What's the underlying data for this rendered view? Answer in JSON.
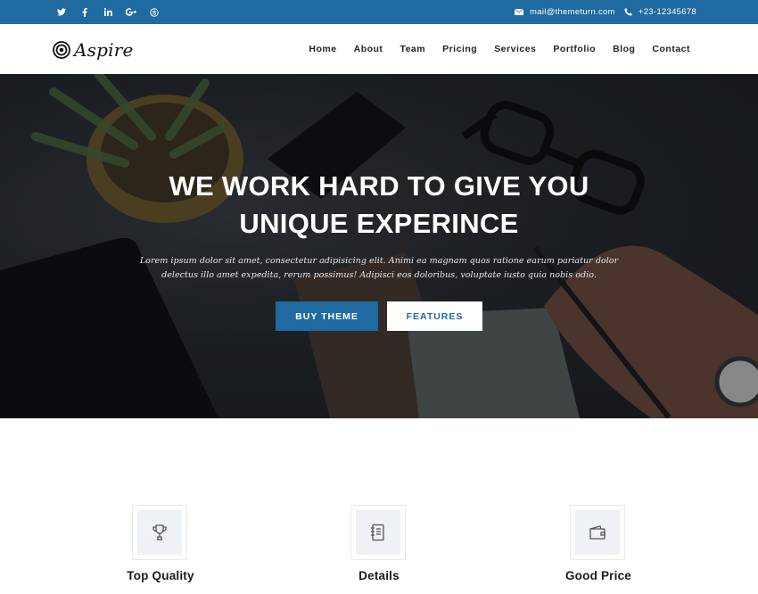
{
  "topbar": {
    "social": [
      {
        "icon": "twitter-icon",
        "glyph": "𝕥"
      },
      {
        "icon": "facebook-icon",
        "glyph": "f"
      },
      {
        "icon": "linkedin-icon",
        "glyph": "in"
      },
      {
        "icon": "google-plus-icon",
        "glyph": "g+"
      },
      {
        "icon": "skype-icon",
        "glyph": "S"
      }
    ],
    "email": "mail@themeturn.com",
    "phone": "+23-12345678",
    "bg_color": "#1f6aa0"
  },
  "navbar": {
    "logo_text": "Aspire",
    "menu": [
      "Home",
      "About",
      "Team",
      "Pricing",
      "Services",
      "Portfolio",
      "Blog",
      "Contact"
    ]
  },
  "hero": {
    "title_line1": "WE WORK HARD TO GIVE YOU",
    "title_line2": "UNIQUE EXPERINCE",
    "description": "Lorem ipsum dolor sit amet, consectetur adipisicing elit. Animi ea magnam quos ratione earum pariatur dolor delectus illo amet expedita, rerum possimus! Adipisci eos doloribus, voluptate iusto quia nobis odio.",
    "primary_button": "BUY THEME",
    "secondary_button": "FEATURES",
    "accent": "#1f6aa0"
  },
  "features": [
    {
      "icon": "trophy-icon",
      "title": "Top Quality"
    },
    {
      "icon": "notebook-icon",
      "title": "Details"
    },
    {
      "icon": "wallet-icon",
      "title": "Good Price"
    }
  ]
}
